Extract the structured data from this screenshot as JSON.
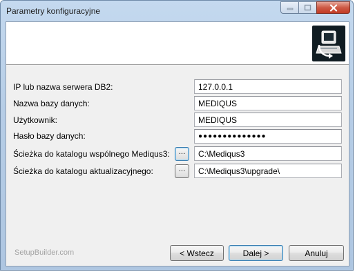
{
  "window": {
    "title": "Parametry konfiguracyjne",
    "controls": {
      "minimize": "minimize-icon",
      "maximize": "maximize-icon",
      "close": "close-icon"
    }
  },
  "header": {
    "logo_icon": "setup-computer-icon"
  },
  "form": {
    "server_label": "IP lub nazwa serwera DB2:",
    "server_value": "127.0.0.1",
    "db_name_label": "Nazwa bazy danych:",
    "db_name_value": "MEDIQUS",
    "user_label": "Użytkownik:",
    "user_value": "MEDIQUS",
    "password_label": "Hasło bazy danych:",
    "password_value": "●●●●●●●●●●●●●●",
    "shared_path_label": "Ścieżka do katalogu wspólnego Mediqus3:",
    "shared_path_browse": "...",
    "shared_path_value": "C:\\Mediqus3",
    "update_path_label": "Ścieżka do katalogu aktualizacyjnego:",
    "update_path_browse": "...",
    "update_path_value": "C:\\Mediqus3\\upgrade\\"
  },
  "footer": {
    "brand": "SetupBuilder.com",
    "back_label": "< Wstecz",
    "next_label": "Dalej >",
    "cancel_label": "Anuluj"
  }
}
